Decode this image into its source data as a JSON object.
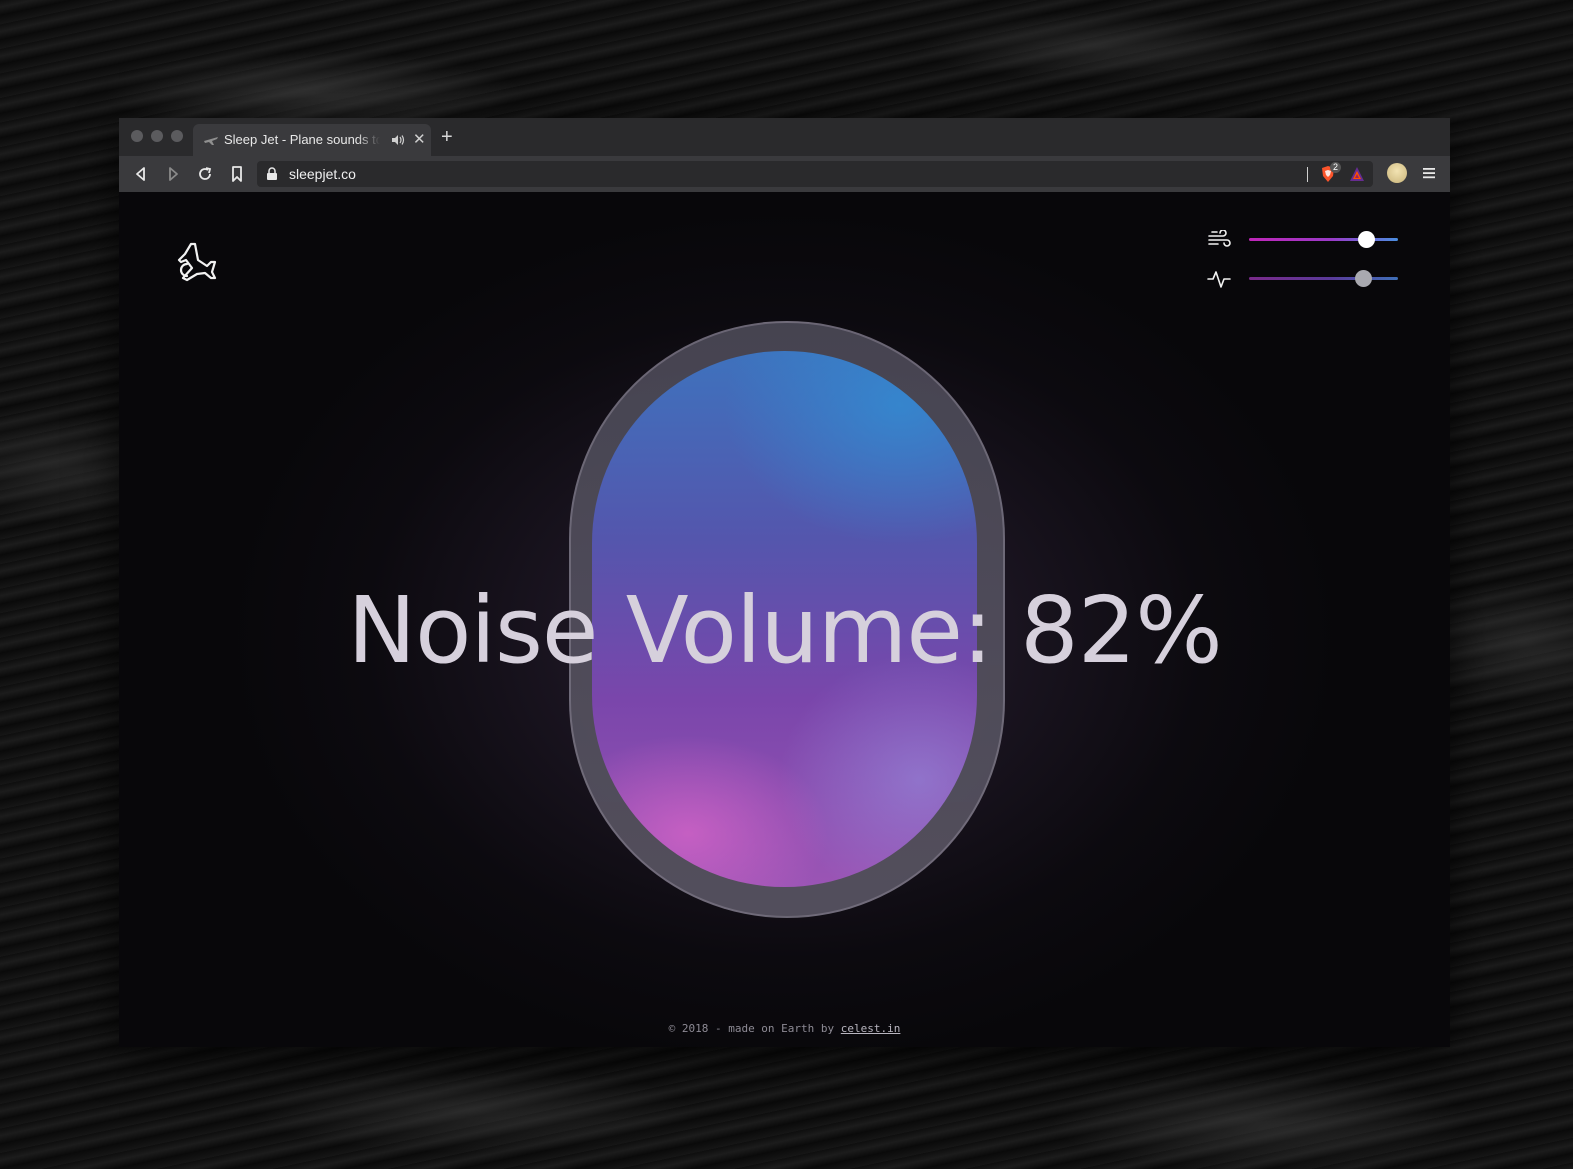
{
  "browser": {
    "tab": {
      "title": "Sleep Jet - Plane sounds to fall asleep",
      "close_label": "✕"
    },
    "new_tab_label": "+",
    "url": "sleepjet.co",
    "brave_shield_count": "2"
  },
  "page": {
    "headline": "Noise Volume: 82%",
    "sliders": [
      {
        "name": "wind",
        "icon": "wind-icon",
        "value": 0.79,
        "knob_color": "#ffffff"
      },
      {
        "name": "pulse",
        "icon": "activity-icon",
        "value": 0.77,
        "knob_color": "#a9a9b0"
      }
    ],
    "footer": {
      "text": "© 2018 - made on Earth by",
      "link": "celest.in"
    }
  },
  "colors": {
    "track_start": "#c026b8",
    "track_end": "#4a8ee0",
    "track2_start": "#7a2a8a",
    "track2_end": "#3f6fb8"
  }
}
